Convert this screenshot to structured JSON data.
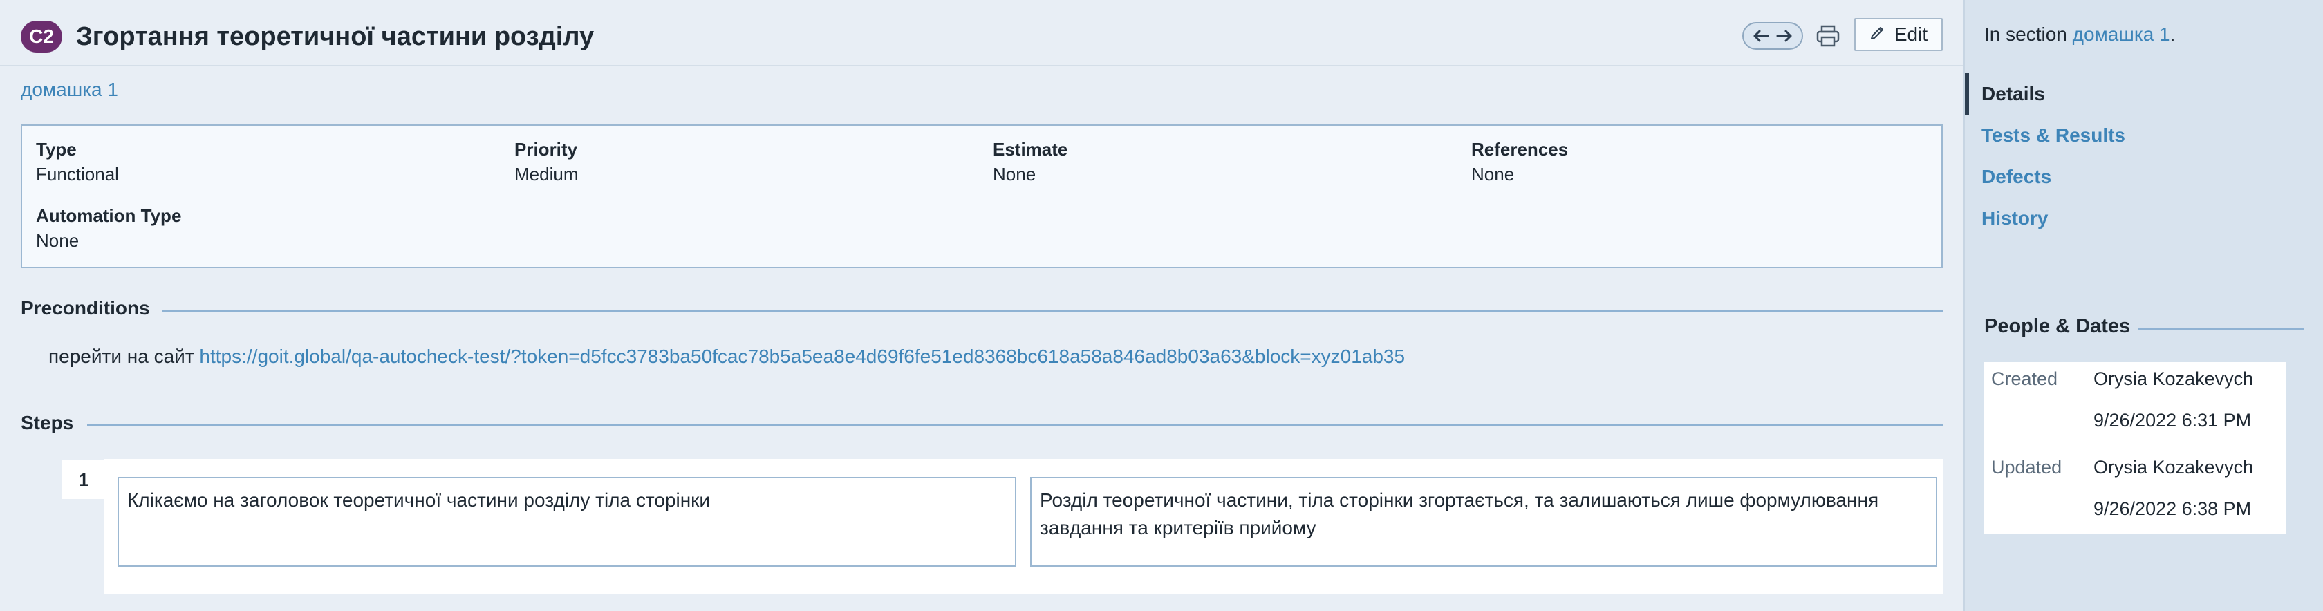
{
  "header": {
    "case_id": "C2",
    "title": "Згортання теоретичної частини розділу",
    "edit_label": "Edit"
  },
  "section_link": "домашка 1",
  "properties": {
    "type_label": "Type",
    "type_value": "Functional",
    "priority_label": "Priority",
    "priority_value": "Medium",
    "estimate_label": "Estimate",
    "estimate_value": "None",
    "references_label": "References",
    "references_value": "None",
    "automation_label": "Automation Type",
    "automation_value": "None"
  },
  "preconditions": {
    "heading": "Preconditions",
    "text": "перейти на сайт",
    "link": "https://goit.global/qa-autocheck-test/?token=d5fcc3783ba50fcac78b5a5ea8e4d69f6fe51ed8368bc618a58a846ad8b03a63&block=xyz01ab35"
  },
  "steps": {
    "heading": "Steps",
    "items": [
      {
        "number": "1",
        "action": "Клікаємо на заголовок теоретичної частини розділу тіла сторінки",
        "expected": "Розділ теоретичної частини, тіла сторінки згортається, та залишаються лише формулювання завдання та критеріїв прийому"
      }
    ]
  },
  "sidebar": {
    "in_section_prefix": "In section",
    "in_section_link": "домашка 1",
    "in_section_suffix": ".",
    "nav": [
      "Details",
      "Tests & Results",
      "Defects",
      "History"
    ],
    "people_heading": "People & Dates",
    "created_label": "Created",
    "created_by": "Orysia Kozakevych",
    "created_at": "9/26/2022 6:31 PM",
    "updated_label": "Updated",
    "updated_by": "Orysia Kozakevych",
    "updated_at": "9/26/2022 6:38 PM"
  },
  "icons": {
    "nav_prev": "arrow-left-icon",
    "nav_next": "arrow-right-icon",
    "print": "printer-icon",
    "edit": "pencil-icon"
  },
  "colors": {
    "badge": "#6b2d6e",
    "link": "#3d84b8",
    "top_bar": "#2d3e50"
  }
}
